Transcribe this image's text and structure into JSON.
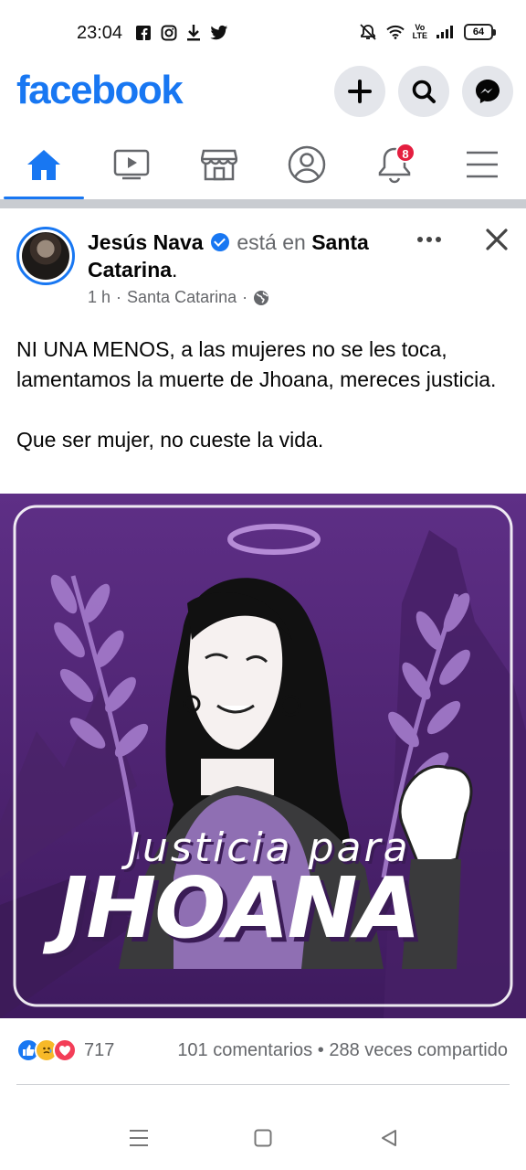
{
  "status_bar": {
    "time": "23:04",
    "battery": "64",
    "volte_top": "Vo",
    "volte_bottom": "LTE",
    "left_icons": [
      "facebook-icon",
      "instagram-icon",
      "download-icon",
      "twitter-icon"
    ],
    "right_icons": [
      "mute-icon",
      "wifi-icon",
      "volte-icon",
      "signal-icon",
      "battery-icon"
    ]
  },
  "header": {
    "logo": "facebook",
    "logo_color": "#1877f2",
    "buttons": [
      "plus-icon",
      "search-icon",
      "messenger-icon"
    ]
  },
  "nav": {
    "tabs": [
      "home-icon",
      "video-icon",
      "marketplace-icon",
      "profile-icon",
      "notifications-icon",
      "menu-icon"
    ],
    "active_tab": "home-icon",
    "notification_badge": "8"
  },
  "post": {
    "author": "Jesús Nava",
    "connector": "está en",
    "place": "Santa Catarina",
    "period": ".",
    "time": "1 h",
    "separator": "·",
    "location": "Santa Catarina",
    "text_line1": "NI UNA MENOS, a las mujeres no se les toca, lamentamos la muerte de Jhoana, mereces justicia.",
    "text_line2": "Que ser mujer, no cueste la vida.",
    "image": {
      "headline": "Justicia para",
      "name": "JHOANA"
    },
    "reactions": {
      "types": [
        "like-icon",
        "care-icon",
        "love-icon"
      ],
      "count": "717"
    },
    "comments": "101 comentarios",
    "dot": "•",
    "shares": "288 veces compartido"
  },
  "colors": {
    "accent": "#1877f2",
    "badge": "#e41e3f",
    "image_purple": "#5e2f86"
  }
}
